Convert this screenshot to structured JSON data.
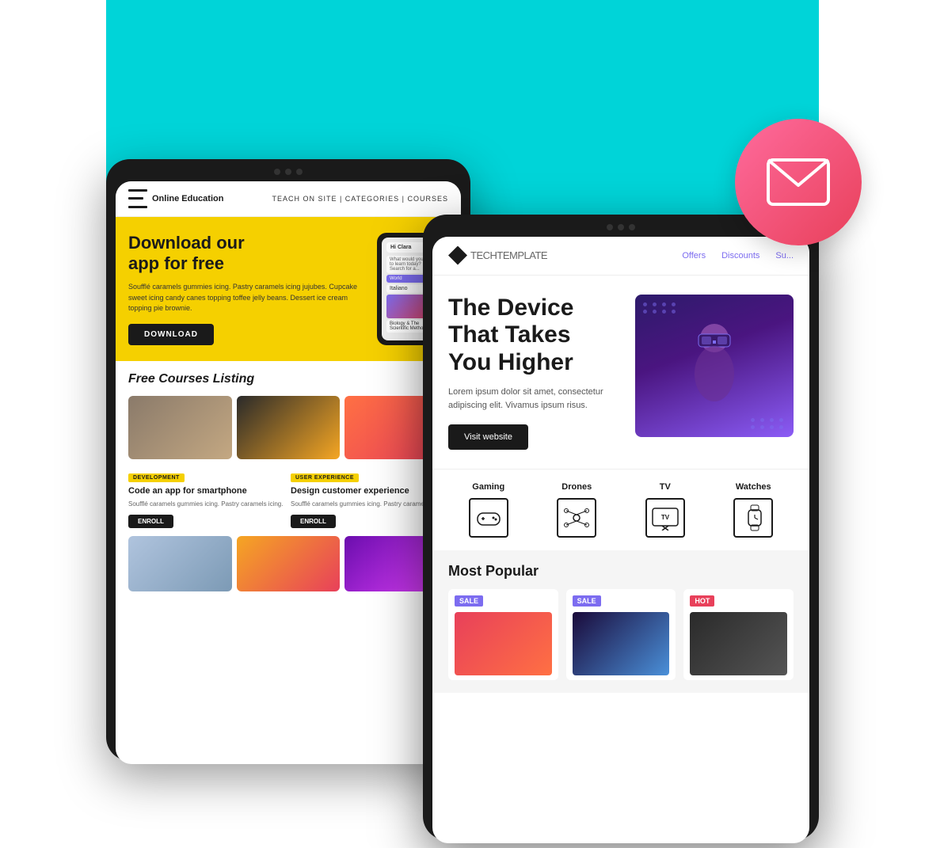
{
  "scene": {
    "arc_color": "#00d4d8"
  },
  "mail_icon": {
    "label": "mail-icon"
  },
  "left_tablet": {
    "navbar": {
      "logo_text": "Online Education",
      "nav_links": "TEACH ON SITE | CATEGORIES | COURSES"
    },
    "hero": {
      "heading_line1": "Download our",
      "heading_line2": "app for free",
      "description": "Soufflé caramels gummies icing. Pastry caramels icing jujubes. Cupcake sweet icing candy canes topping toffee jelly beans. Dessert ice cream topping pie brownie.",
      "button_label": "DOWNLOAD"
    },
    "courses_section": {
      "heading": "Free Courses Listing",
      "tag_development": "DEVELOPMENT",
      "tag_ux": "USER EXPERIENCE",
      "course1_title": "Code an app for smartphone",
      "course1_desc": "Soufflé caramels gummies icing. Pastry caramels icing.",
      "course2_title": "Design customer experience",
      "course2_desc": "Soufflé caramels gummies icing. Pastry caramels icing.",
      "enroll_label": "ENROLL"
    },
    "phone": {
      "greeting": "Hi Clara",
      "subtitle": "What would you like to learn today? Search for a..."
    }
  },
  "right_tablet": {
    "navbar": {
      "logo_bold": "TECH",
      "logo_light": "TEMPLATE",
      "nav_offers": "Offers",
      "nav_discounts": "Discounts",
      "nav_sub": "Su..."
    },
    "hero": {
      "heading": "The Device That Takes You Higher",
      "description": "Lorem ipsum dolor sit amet, consectetur adipiscing elit. Vivamus ipsum risus.",
      "button_label": "Visit website"
    },
    "categories": {
      "gaming": "Gaming",
      "drones": "Drones",
      "tv": "TV",
      "watches": "Watches"
    },
    "popular": {
      "heading": "Most Popular",
      "badge1": "SALE",
      "badge2": "SALE",
      "badge3": "HOT"
    }
  }
}
